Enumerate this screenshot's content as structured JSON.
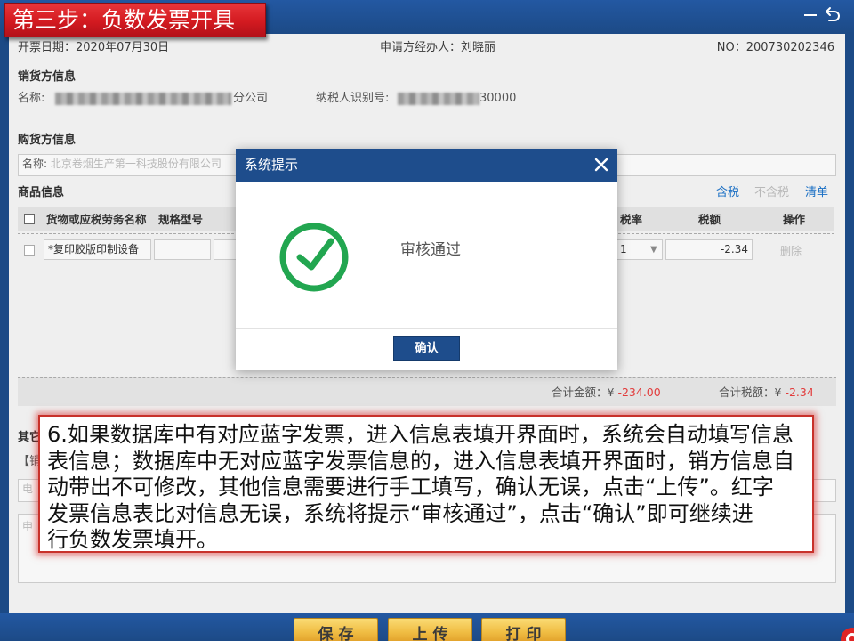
{
  "tutorial": {
    "step_banner": "第三步：负数发票开具",
    "instruction_lines": [
      "6.如果数据库中有对应蓝字发票，进入信息表填开界面时，系统会自动填写信息",
      "表信息；数据库中无对应蓝字发票信息的，进入信息表填开界面时，销方信息自",
      "动带出不可修改，其他信息需要进行手工填写，确认无误，点击“上传”。红字",
      "发票信息表比对信息无误，系统将提示“审核通过”，点击“确认”即可继续进",
      "行负数发票填开。"
    ]
  },
  "window": {
    "minimize_icon": "minus-icon",
    "back_icon": "return-icon"
  },
  "header": {
    "invoice_date": "开票日期：2020年07月30日",
    "applicant_agent": "申请方经办人：刘晓丽",
    "number": "NO：200730202346"
  },
  "seller": {
    "title": "销货方信息",
    "name_label": "名称:",
    "name_visible": "分公司",
    "tax_id_label": "纳税人识别号:",
    "tax_id_visible": "30000"
  },
  "buyer": {
    "title": "购货方信息",
    "name_label": "名称:",
    "name_value": "北京卷烟生产第一科技股份有限公司"
  },
  "goods": {
    "title": "商品信息",
    "tax_modes": {
      "inclusive": "含税",
      "exclusive": "不含税",
      "list": "清单"
    },
    "columns": {
      "name": "货物或应税劳务名称",
      "spec": "规格型号",
      "tax_rate": "税率",
      "tax_amount": "税额",
      "action": "操作"
    },
    "rows": [
      {
        "name": "*复印胶版印制设备",
        "tax_rate": "1",
        "tax_amount": "-2.34",
        "action": "删除"
      }
    ],
    "totals": {
      "amount_label": "合计金额：",
      "amount_currency": "¥",
      "amount_value": "-234.00",
      "tax_label": "合计税额：",
      "tax_currency": "¥",
      "tax_value": "-2.34"
    }
  },
  "other": {
    "title": "其它",
    "seller_note": "【销",
    "phone_placeholder": "电",
    "apply_placeholder": "申"
  },
  "dialog": {
    "title": "系统提示",
    "close_icon": "close-icon",
    "status_icon": "check-circle-icon",
    "message": "审核通过",
    "confirm_label": "确认"
  },
  "footer": {
    "save_label": "保 存",
    "upload_label": "上 传",
    "print_label": "打 印",
    "logo_icon": "logo-icon"
  },
  "colors": {
    "frame_blue": "#1c4a86",
    "banner_red": "#d31a20",
    "success_green": "#22a650",
    "negative_red": "#e23b3b",
    "link_blue": "#1a6fc4",
    "button_gold": "#f0bd43",
    "dialog_blue": "#1e4d8c"
  }
}
